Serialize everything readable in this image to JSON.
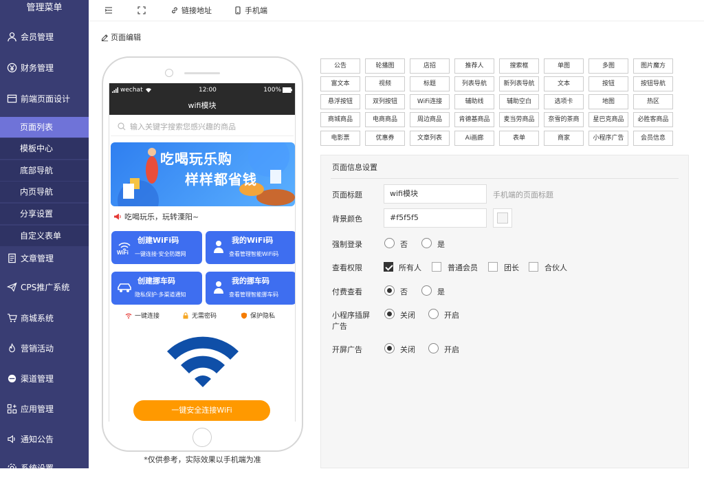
{
  "sidebar": {
    "title": "管理菜单",
    "items": [
      {
        "label": "会员管理",
        "icon": "user-icon"
      },
      {
        "label": "财务管理",
        "icon": "yen-icon"
      },
      {
        "label": "前端页面设计",
        "icon": "layout-icon"
      },
      {
        "label": "文章管理",
        "icon": "document-icon"
      },
      {
        "label": "CPS推广系统",
        "icon": "send-icon"
      },
      {
        "label": "商城系统",
        "icon": "cart-icon"
      },
      {
        "label": "营销活动",
        "icon": "fire-icon"
      },
      {
        "label": "渠道管理",
        "icon": "circle-icon"
      },
      {
        "label": "应用管理",
        "icon": "apps-icon"
      },
      {
        "label": "通知公告",
        "icon": "speaker-icon"
      },
      {
        "label": "系统设置",
        "icon": "settings-icon"
      }
    ],
    "subitems": [
      "页面列表",
      "模板中心",
      "底部导航",
      "内页导航",
      "分享设置",
      "自定义表单"
    ]
  },
  "topbar": {
    "link_label": "链接地址",
    "mobile_label": "手机端"
  },
  "editbar": {
    "label": "页面编辑"
  },
  "phone": {
    "carrier": "wechat",
    "time": "12:00",
    "battery": "100%",
    "page_title": "wifi模块",
    "search_placeholder": "输入关键字搜索您感兴趣的商品",
    "banner_line1": "吃喝玩乐购",
    "banner_line2": "样样都省钱",
    "notice": "吃喝玩乐，玩转溧阳~",
    "cards": [
      {
        "title": "创建WiFi码",
        "sub": "一键连接·安全防蹭网"
      },
      {
        "title": "我的WiFi码",
        "sub": "查看管理智能WiFi码"
      },
      {
        "title": "创建挪车码",
        "sub": "隐私保护·多渠道通知"
      },
      {
        "title": "我的挪车码",
        "sub": "查看管理智能挪车码"
      }
    ],
    "features": [
      "一键连接",
      "无需密码",
      "保护隐私"
    ],
    "connect_button": "一键安全连接WiFi"
  },
  "note": "*仅供参考，实际效果以手机端为准",
  "components": [
    "公告",
    "轮播图",
    "店招",
    "推荐人",
    "搜索框",
    "单图",
    "多图",
    "图片魔方",
    "富文本",
    "视频",
    "标题",
    "列表导航",
    "新列表导航",
    "文本",
    "按钮",
    "按钮导航",
    "悬浮按钮",
    "双列按钮",
    "WiFi连接",
    "辅助线",
    "辅助空白",
    "选项卡",
    "地图",
    "热区",
    "商城商品",
    "电商商品",
    "周边商品",
    "肯德基商品",
    "麦当劳商品",
    "奈雪的茶商",
    "星巴克商品",
    "必胜客商品",
    "电影票",
    "优惠券",
    "文章列表",
    "Ai画廊",
    "表单",
    "商家",
    "小程序广告",
    "会员信息"
  ],
  "settings": {
    "panel_title": "页面信息设置",
    "page_title_label": "页面标题",
    "page_title_value": "wifi模块",
    "page_title_hint": "手机端的页面标题",
    "bg_label": "背景颜色",
    "bg_value": "#f5f5f5",
    "force_login_label": "强制登录",
    "no": "否",
    "yes": "是",
    "view_perm_label": "查看权限",
    "perms": [
      "所有人",
      "普通会员",
      "团长",
      "合伙人"
    ],
    "paid_view_label": "付费查看",
    "interstitial_label_1": "小程序插屏",
    "interstitial_label_2": "广告",
    "off": "关闭",
    "on": "开启",
    "splash_label": "开屏广告"
  },
  "colors": {
    "sidebar_bg": "#393D73",
    "active_sub": "#6f73d8",
    "card_blue": "#3e6ef0",
    "button_orange": "#ff9900"
  }
}
